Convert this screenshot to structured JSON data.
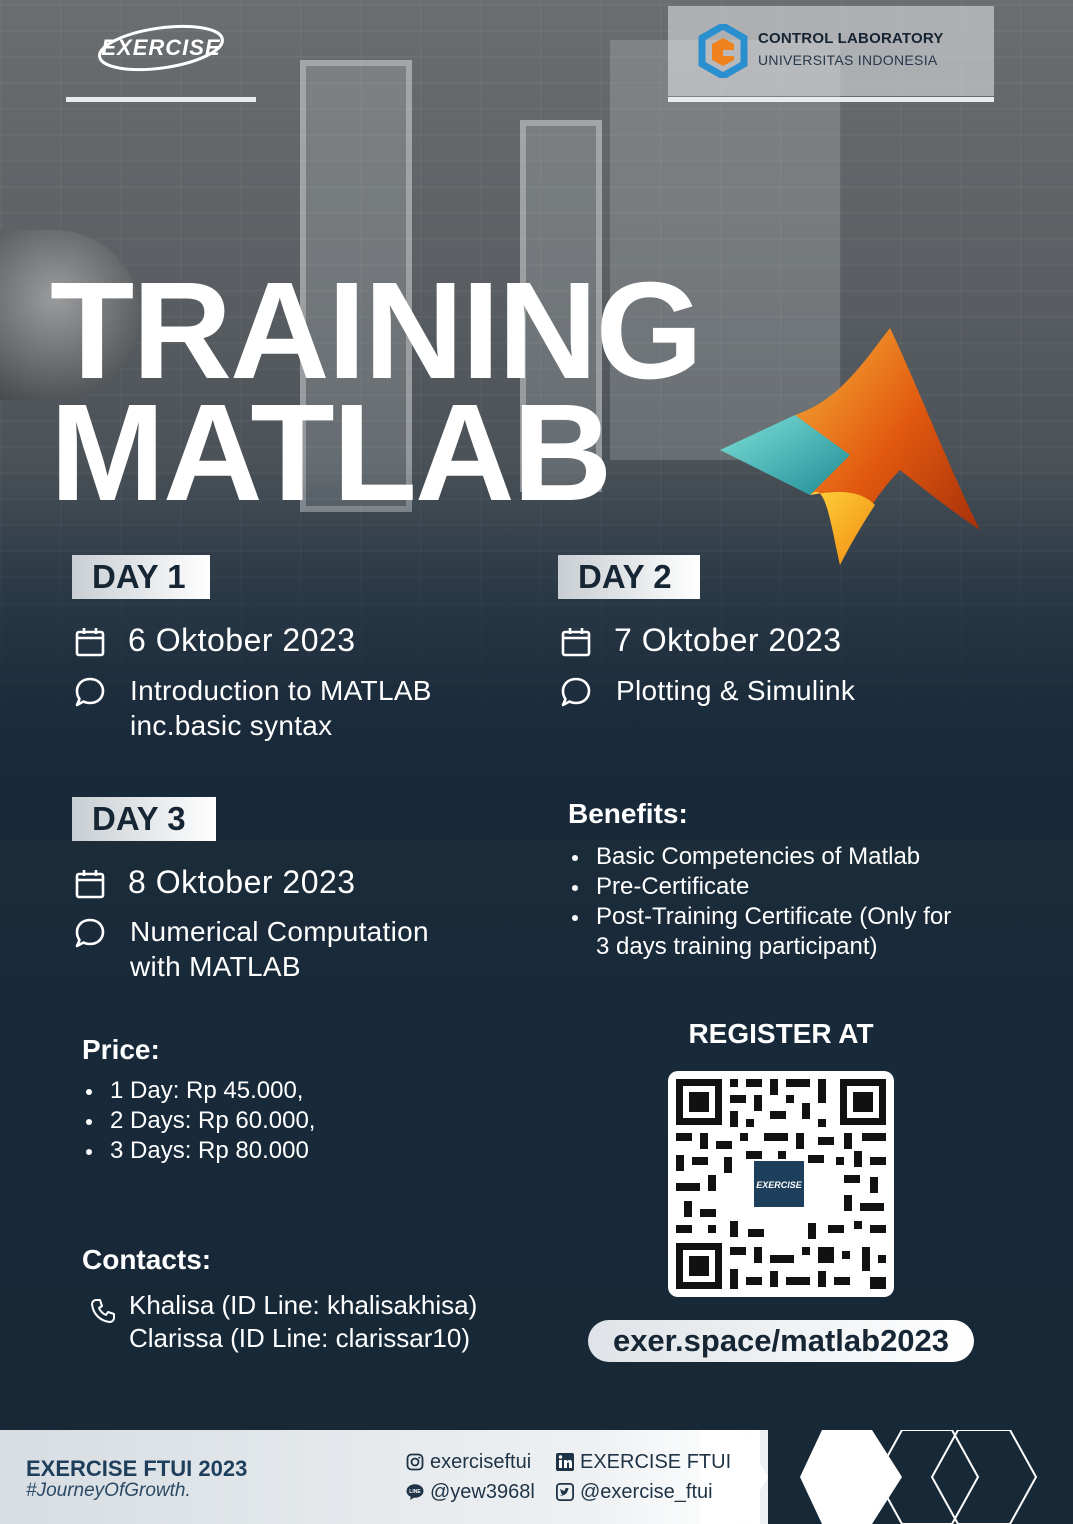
{
  "header": {
    "logo_text": "EXERCISE",
    "partner_name": "CONTROL LABORATORY",
    "partner_sub": "UNIVERSITAS INDONESIA"
  },
  "title": {
    "line1": "TRAINING",
    "line2": "MATLAB"
  },
  "days": [
    {
      "badge": "DAY 1",
      "date": "6 Oktober 2023",
      "topic_line1": "Introduction to MATLAB",
      "topic_line2": "inc.basic syntax"
    },
    {
      "badge": "DAY 2",
      "date": "7 Oktober 2023",
      "topic_line1": "Plotting & Simulink",
      "topic_line2": ""
    },
    {
      "badge": "DAY 3",
      "date": "8 Oktober 2023",
      "topic_line1": "Numerical Computation",
      "topic_line2": "with MATLAB"
    }
  ],
  "benefits": {
    "title": "Benefits:",
    "items": [
      "Basic Competencies of Matlab",
      "Pre-Certificate",
      "Post-Training  Certificate  (Only  for",
      "3 days training participant)"
    ]
  },
  "price": {
    "title": "Price:",
    "items": [
      "1 Day: Rp 45.000,",
      "2 Days: Rp 60.000,",
      "3 Days: Rp 80.000"
    ]
  },
  "contacts": {
    "title": "Contacts:",
    "line1": "Khalisa (ID Line: khalisakhisa)",
    "line2": "Clarissa (ID  Line: clarissar10)"
  },
  "register": {
    "title": "REGISTER AT",
    "qr_center_text": "EXERCISE",
    "url": "exer.space/matlab2023"
  },
  "footer": {
    "brand": "EXERCISE FTUI 2023",
    "tagline": "#JourneyOfGrowth.",
    "instagram": "exerciseftui",
    "linkedin": "EXERCISE FTUI",
    "line": "@yew3968l",
    "twitter": "@exercise_ftui"
  },
  "colors": {
    "navy": "#172836",
    "white": "#ffffff",
    "matlab_orange": "#e2590f",
    "matlab_teal": "#3fb9b3",
    "ctl_blue": "#2a8fcf",
    "ctl_orange": "#f0821e"
  }
}
